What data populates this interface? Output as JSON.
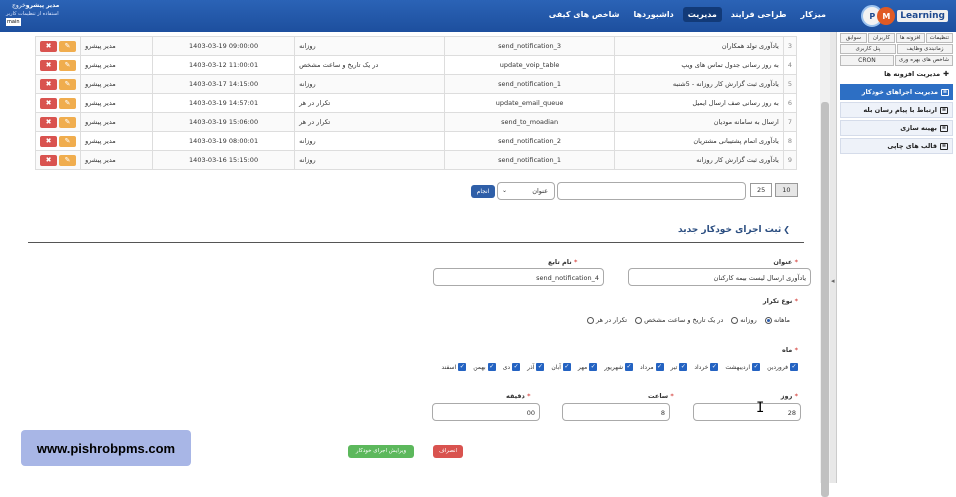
{
  "header": {
    "brand_short": "PMS",
    "brand_text": "Learning",
    "nav": [
      "میزکار",
      "طراحی فرایند",
      "مدیریت",
      "داشبوردها",
      "شاخص های کیفی"
    ],
    "nav_active_index": 2,
    "user_name": "مدیر پیشرو",
    "exit": "خروج",
    "user_sub": "استفاده از تنظیمات کاربر",
    "user_tag": "main"
  },
  "sidebar": {
    "tabs_row1": [
      "تنظیمات",
      "افزونه ها",
      "کاربران",
      "سوابق"
    ],
    "tabs_row2": [
      "زمانبندی وظایف",
      "پنل کاربری"
    ],
    "tabs_row3": [
      "شاخص های بهره وری",
      "CRON"
    ],
    "menu_title": "مدیریت افزونه ها",
    "items": [
      "مدیریت اجراهای خودکار",
      "ارتباط با پیام رسان بله",
      "بهینه سازی",
      "قالب های چاپی"
    ]
  },
  "table": {
    "rows": [
      {
        "num": "3",
        "title": "یادآوری تولد همکاران",
        "code": "send_notification_3",
        "type": "روزانه",
        "date": "1403-03-19 09:00:00",
        "user": "مدیر پیشرو"
      },
      {
        "num": "4",
        "title": "به روز رسانی جدول تماس های ویپ",
        "code": "update_voip_table",
        "type": "در یک تاریخ و ساعت مشخص",
        "date": "1403-03-12 11:00:01",
        "user": "مدیر پیشرو"
      },
      {
        "num": "5",
        "title": "یادآوری ثبت گزارش کار روزانه - 5شنبه",
        "code": "send_notification_1",
        "type": "روزانه",
        "date": "1403-03-17 14:15:00",
        "user": "مدیر پیشرو"
      },
      {
        "num": "6",
        "title": "به روز رسانی صف ارسال ایمیل",
        "code": "update_email_queue",
        "type": "تکرار در هر",
        "date": "1403-03-19 14:57:01",
        "user": "مدیر پیشرو"
      },
      {
        "num": "7",
        "title": "ارسال به سامانه مودیان",
        "code": "send_to_moadian",
        "type": "تکرار در هر",
        "date": "1403-03-19 15:06:00",
        "user": "مدیر پیشرو"
      },
      {
        "num": "8",
        "title": "یادآوری اتمام پشتیبانی مشتریان",
        "code": "send_notification_2",
        "type": "روزانه",
        "date": "1403-03-19 08:00:01",
        "user": "مدیر پیشرو"
      },
      {
        "num": "9",
        "title": "یادآوری ثبت گزارش کار روزانه",
        "code": "send_notification_1",
        "type": "روزانه",
        "date": "1403-03-16 15:15:00",
        "user": "مدیر پیشرو"
      }
    ],
    "edit_glyph": "✎",
    "delete_glyph": "✖"
  },
  "pager": {
    "size_10": "10",
    "size_25": "25",
    "select_value": "عنوان",
    "do_label": "انجام"
  },
  "form": {
    "section_title": "ثبت اجرای خودکار جدید",
    "title_label": "عنوان",
    "title_value": "یادآوری ارسال لیست بیمه کارکنان",
    "func_label": "نام تابع",
    "func_value": "send_notification_4",
    "repeat_label": "نوع تکرار",
    "repeat_options": [
      "تکرار در هر",
      "در یک تاریخ و ساعت مشخص",
      "روزانه",
      "ماهانه"
    ],
    "repeat_selected": 3,
    "month_label": "ماه",
    "months": [
      "فروردین",
      "اردیبهشت",
      "خرداد",
      "تیر",
      "مرداد",
      "شهریور",
      "مهر",
      "آبان",
      "آذر",
      "دی",
      "بهمن",
      "اسفند"
    ],
    "day_label": "روز",
    "day_value": "28",
    "hour_label": "ساعت",
    "hour_value": "8",
    "minute_label": "دقیقه",
    "minute_value": "00",
    "save_label": "ویرایش اجرای خودکار",
    "cancel_label": "انصراف"
  },
  "watermark": "www.pishrobpms.com",
  "colors": {
    "header": "#1d4f9e",
    "active_menu": "#2d6fc4",
    "delete": "#d9534f",
    "edit": "#f0ad4e",
    "save": "#5cb85c"
  }
}
